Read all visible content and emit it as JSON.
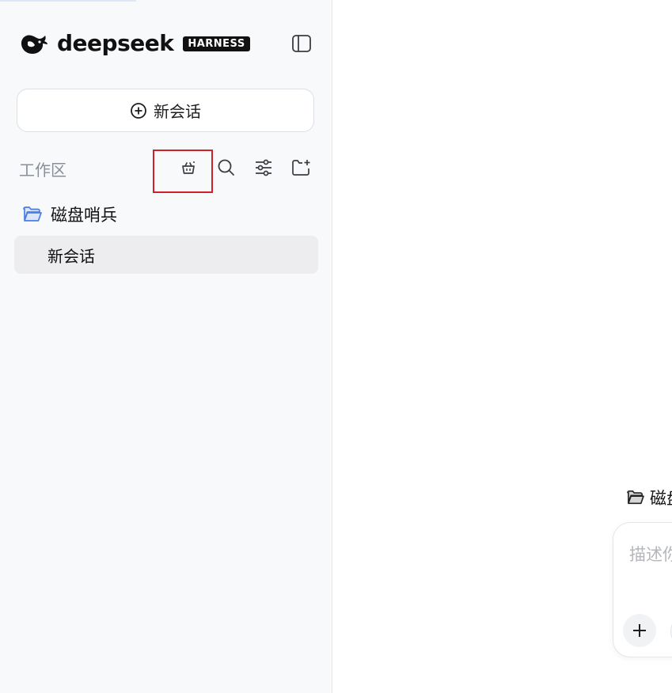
{
  "brand": {
    "wordmark": "deepseek",
    "badge": "HARNESS"
  },
  "sidebar": {
    "toggle_icon": "sidebar-toggle-icon",
    "new_chat_label": "新会话",
    "new_chat_icon": "plus-circle-icon",
    "workspace_label": "工作区",
    "tools": [
      {
        "name": "cleanup-basket-icon",
        "highlighted": true
      },
      {
        "name": "search-icon"
      },
      {
        "name": "filter-sliders-icon"
      },
      {
        "name": "new-folder-icon"
      }
    ],
    "folder": {
      "label": "磁盘哨兵",
      "icon": "folder-open-icon",
      "icon_color": "#4a7ee6"
    },
    "sessions": [
      {
        "label": "新会话",
        "active": true
      }
    ]
  },
  "main": {
    "folder_label": "磁盘",
    "folder_icon": "folder-open-icon",
    "composer": {
      "placeholder": "描述你",
      "add_icon": "plus-icon"
    }
  },
  "colors": {
    "sidebar_bg": "#f8f9fb",
    "active_item_bg": "#ededef",
    "highlight_box": "#d0202a",
    "folder_icon": "#4a7ee6"
  }
}
